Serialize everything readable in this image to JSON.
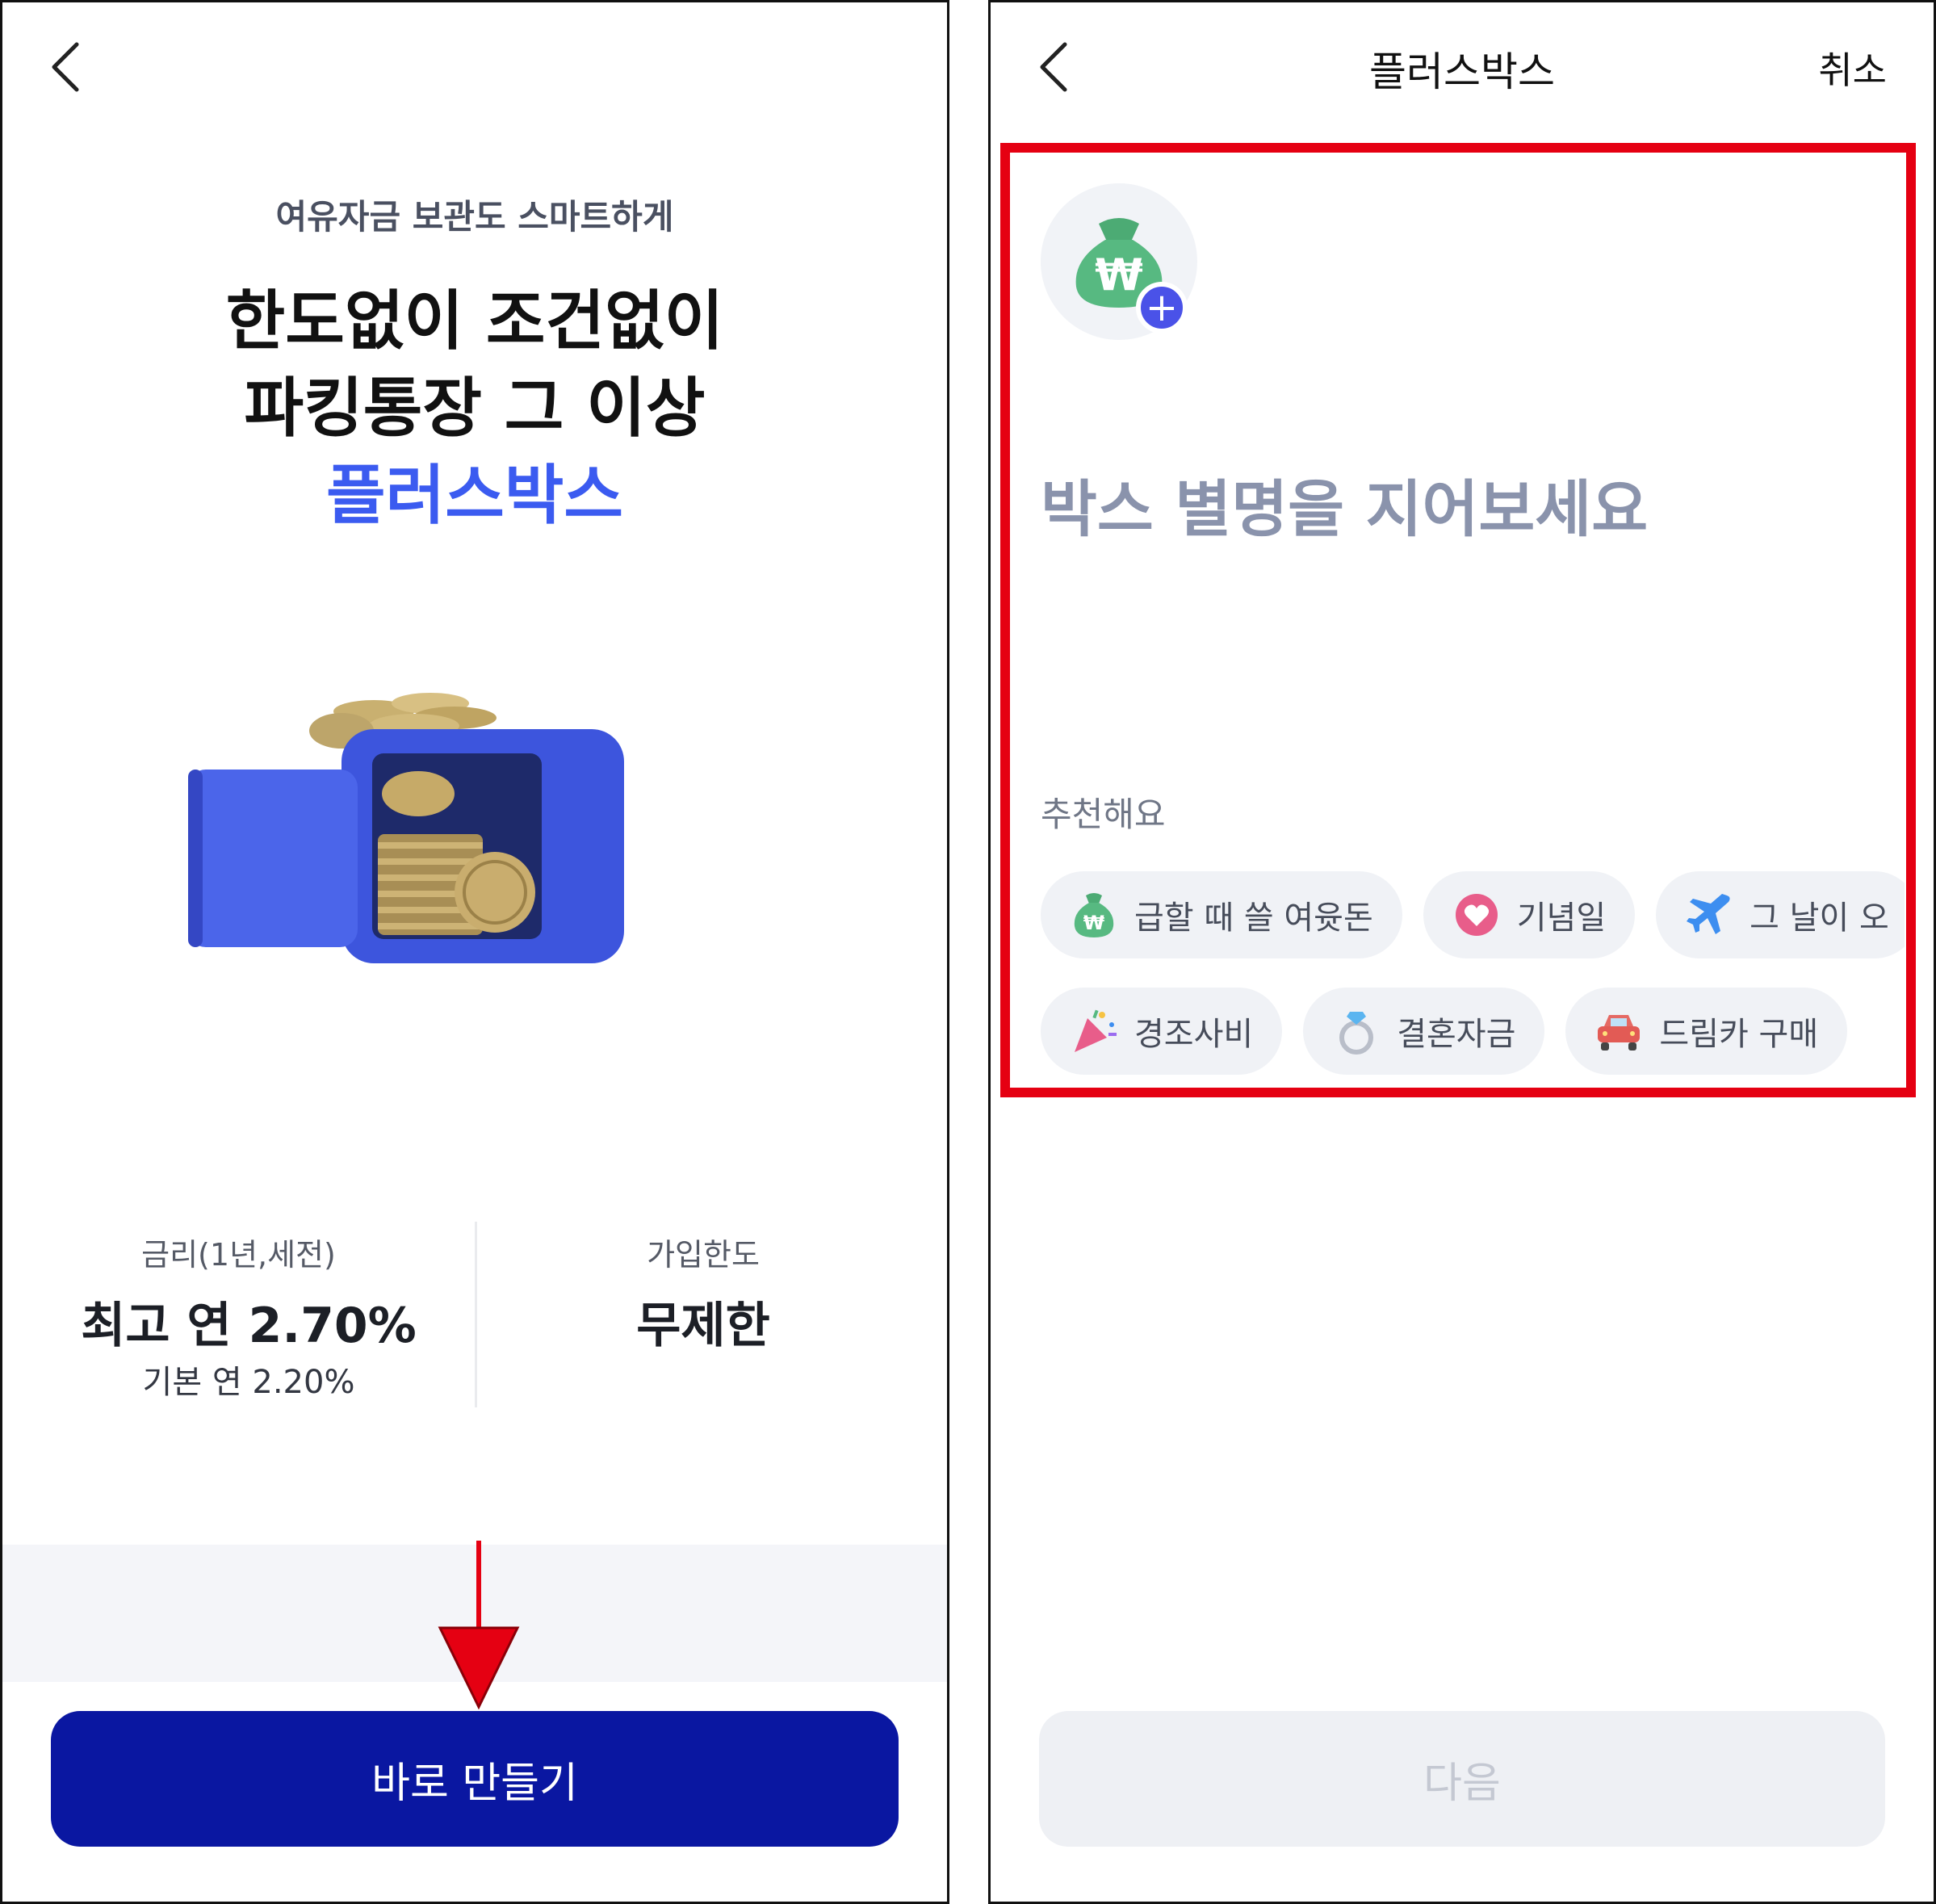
{
  "left": {
    "subtitle": "여유자금 보관도 스마트하게",
    "headline_line1": "한도없이 조건없이",
    "headline_line2": "파킹통장 그 이상",
    "headline_line3": "플러스박스",
    "stats": {
      "rate_label": "금리(1년,세전)",
      "rate_max": "최고 연 2.70%",
      "rate_base": "기본 연 2.20%",
      "limit_label": "가입한도",
      "limit_value": "무제한"
    },
    "cta_label": "바로 만들기"
  },
  "right": {
    "nav_title": "플러스박스",
    "nav_cancel": "취소",
    "name_placeholder": "박스 별명을 지어보세요",
    "recommend_label": "추천해요",
    "chips_row1": [
      {
        "label": "급할 때 쓸 여윳돈",
        "icon": "money-bag-icon"
      },
      {
        "label": "기념일",
        "icon": "heart-bubble-icon"
      },
      {
        "label": "그 날이 오",
        "icon": "airplane-icon"
      }
    ],
    "chips_row2": [
      {
        "label": "경조사비",
        "icon": "party-popper-icon"
      },
      {
        "label": "결혼자금",
        "icon": "ring-icon"
      },
      {
        "label": "드림카 구매",
        "icon": "car-icon"
      }
    ],
    "next_label": "다음"
  },
  "colors": {
    "accent_blue": "#3b5bf0",
    "cta_navy": "#0a17a1",
    "highlight_red": "#e50012",
    "placeholder_gray": "#8a93ac"
  }
}
